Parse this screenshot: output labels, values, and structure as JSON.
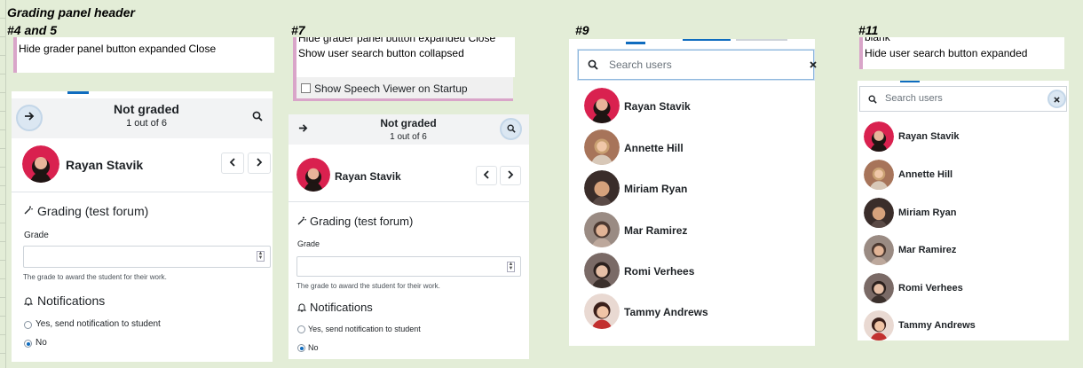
{
  "heading": "Grading panel header",
  "panels": [
    {
      "label": "#4 and 5",
      "screen_reader_lines": [
        "Hide grader panel  button  expanded  Close"
      ],
      "status": "Not graded",
      "count": "1 out of 6",
      "student": "Rayan Stavik",
      "grading_title": "Grading (test forum)",
      "grade_label": "Grade",
      "grade_help": "The grade to award the student for their work.",
      "notifications_title": "Notifications",
      "notify_yes": "Yes, send notification to student",
      "notify_no": "No"
    },
    {
      "label": "#7",
      "screen_reader_lines": [
        "Hide grader panel  button  expanded  Close",
        "Show user search  button  collapsed"
      ],
      "speech_viewer_option": "Show Speech Viewer on Startup",
      "status": "Not graded",
      "count": "1 out of 6",
      "student": "Rayan Stavik",
      "grading_title": "Grading (test forum)",
      "grade_label": "Grade",
      "grade_help": "The grade to award the student for their work.",
      "notifications_title": "Notifications",
      "notify_yes": "Yes, send notification to student",
      "notify_no": "No"
    },
    {
      "label": "#9",
      "search_placeholder": "Search users",
      "users": [
        "Rayan Stavik",
        "Annette Hill",
        "Miriam Ryan",
        "Mar Ramirez",
        "Romi Verhees",
        "Tammy Andrews"
      ]
    },
    {
      "label": "#11",
      "screen_reader_lines": [
        "blank",
        "Hide user search  button  expanded"
      ],
      "search_placeholder": "Search users",
      "users": [
        "Rayan Stavik",
        "Annette Hill",
        "Miriam Ryan",
        "Mar Ramirez",
        "Romi Verhees",
        "Tammy Andrews"
      ]
    }
  ],
  "icons": {
    "expand": "arrow-right-icon",
    "search": "search-icon",
    "prev": "chevron-left-icon",
    "next": "chevron-right-icon",
    "grading": "magic-wand-icon",
    "notifications": "bell-icon",
    "clear": "close-icon"
  },
  "colors": {
    "page_background": "#e3edd7",
    "accent": "#0f6cbf",
    "screen_reader_border": "#d9a5c9"
  }
}
